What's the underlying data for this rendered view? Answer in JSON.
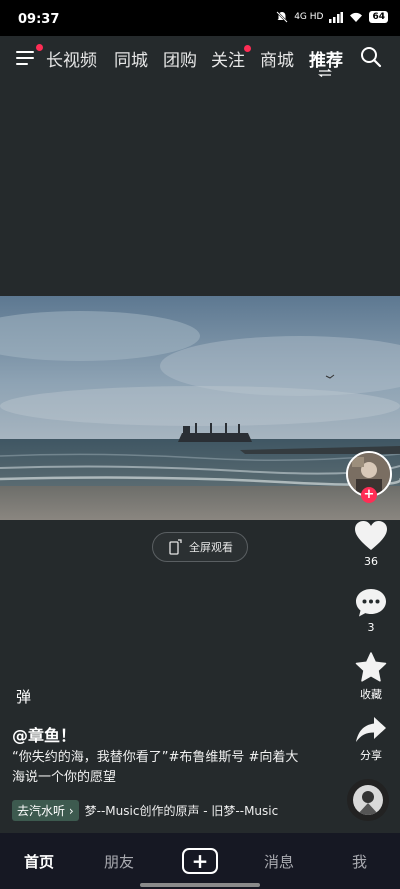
{
  "status": {
    "time": "09:37",
    "network": "4G HD",
    "battery": "64"
  },
  "nav": {
    "tabs": [
      "长视频",
      "同城",
      "团购",
      "关注",
      "商城",
      "推荐"
    ],
    "active_tab": "推荐"
  },
  "video": {
    "fullscreen_label": "全屏观看"
  },
  "actions": {
    "likes": "36",
    "comments": "3",
    "favorite": "收藏",
    "share": "分享"
  },
  "post": {
    "danmu": "弹",
    "author": "@章鱼！",
    "description": "“你失约的海，我替你看了”#布鲁维斯号 #向着大海说一个你的愿望",
    "chip": "去汽水听",
    "music": "梦--Music创作的原声 - 旧梦--Music"
  },
  "bottom": {
    "home": "首页",
    "friends": "朋友",
    "plus": "+",
    "messages": "消息",
    "me": "我"
  },
  "colors": {
    "accent": "#ff2d55",
    "background": "#252a2c"
  }
}
